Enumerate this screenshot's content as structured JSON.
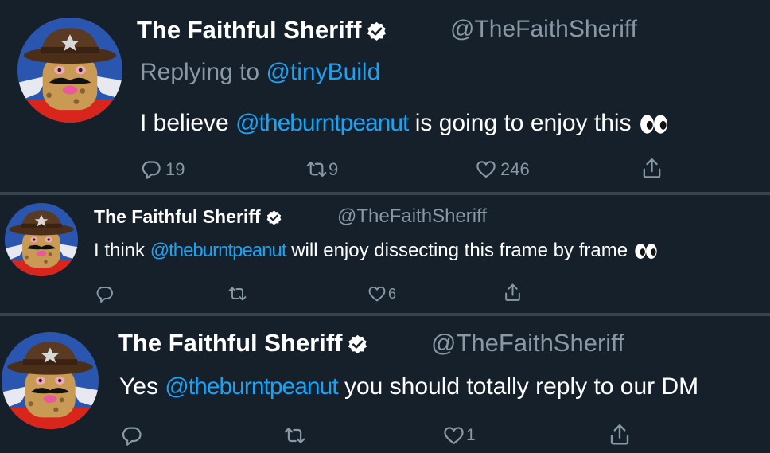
{
  "tweets": [
    {
      "name": "The Faithful Sheriff",
      "handle": "@TheFaithSheriff",
      "replying_prefix": "Replying to",
      "replying_to": "@tinyBuild",
      "text_before": "I believe",
      "mention": "@theburntpeanut",
      "text_after": "is going to enjoy this",
      "emoji": "eyes-icon",
      "reply_count": "19",
      "retweet_count": "9",
      "like_count": "246"
    },
    {
      "name": "The Faithful Sheriff",
      "handle": "@TheFaithSheriff",
      "text_before": "I think",
      "mention": "@theburntpeanut",
      "text_after": "will enjoy dissecting this frame by frame",
      "emoji": "eyes-icon",
      "reply_count": "",
      "retweet_count": "",
      "like_count": "6"
    },
    {
      "name": "The Faithful Sheriff",
      "handle": "@TheFaithSheriff",
      "text_before": "Yes",
      "mention": "@theburntpeanut",
      "text_after": "you should totally reply to our DM",
      "reply_count": "",
      "retweet_count": "",
      "like_count": "1"
    }
  ],
  "colors": {
    "background": "#15202b",
    "separator": "#38444d",
    "muted_text": "#8899a6",
    "mention": "#1da1f2"
  }
}
